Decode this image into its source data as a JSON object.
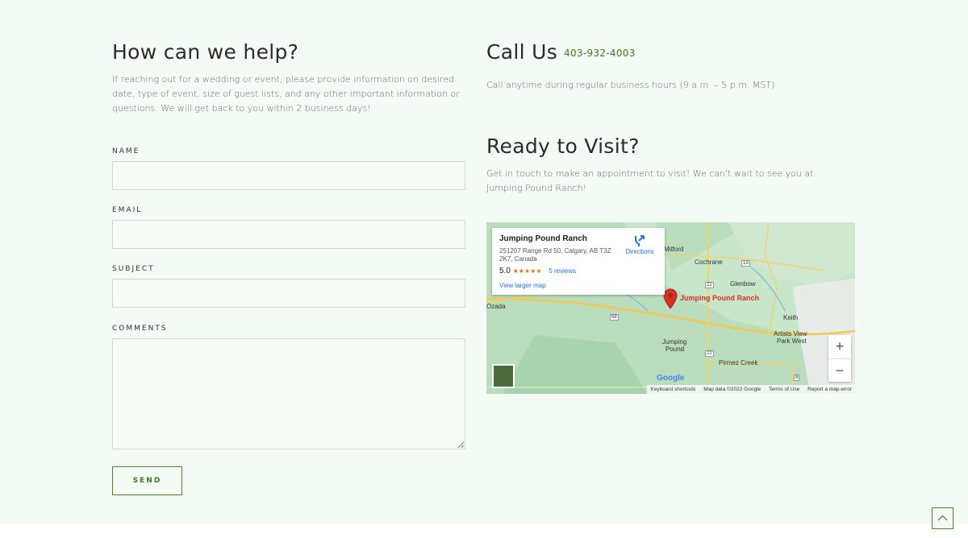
{
  "help": {
    "title": "How can we help?",
    "intro": "If reaching out for a wedding or event, please provide information on desired date, type of event, size of guest lists, and any other important information or questions. We will get back to you within 2 business days!"
  },
  "form": {
    "name_label": "NAME",
    "email_label": "EMAIL",
    "subject_label": "SUBJECT",
    "comments_label": "COMMENTS",
    "send_label": "SEND"
  },
  "call": {
    "title": "Call Us",
    "phone": "403-932-4003",
    "hours": "Call anytime during regular business hours (9 a.m. – 5 p.m. MST)"
  },
  "visit": {
    "title": "Ready to Visit?",
    "text": "Get in touch to make an appointment to visit! We can't wait to see you at Jumping Pound Ranch!"
  },
  "map": {
    "place_name": "Jumping Pound Ranch",
    "address": "251207 Range Rd 50, Calgary, AB T3Z 2K7, Canada",
    "rating": "5.0",
    "stars": "★★★★★",
    "reviews": "5 reviews",
    "larger_map": "View larger map",
    "directions": "Directions",
    "pin_label": "Jumping Pound Ranch",
    "towns": {
      "mitford": "Mitford",
      "cochrane": "Cochrane",
      "glenbow": "Glenbow",
      "ozada": "Ozada",
      "keith": "Keith",
      "artists_view": "Artists View",
      "park_west": "Park West",
      "jumping": "Jumping",
      "pound": "Pound",
      "pirmez": "Pirmez Creek"
    },
    "roads": {
      "r1a": "1A",
      "r22a": "22",
      "r68": "68",
      "r22b": "22",
      "r8": "8"
    },
    "zoom_in": "+",
    "zoom_out": "−",
    "google": "Google",
    "keyboard": "Keyboard shortcuts",
    "mapdata": "Map data ©2022 Google",
    "terms": "Terms of Use",
    "report": "Report a map error"
  },
  "colors": {
    "accent": "#3e7a1e",
    "background": "#f4faf4",
    "pin": "#d93025"
  },
  "icons": {
    "scroll_top": "chevron-up-icon",
    "directions": "directions-icon",
    "pin": "map-pin-icon"
  }
}
